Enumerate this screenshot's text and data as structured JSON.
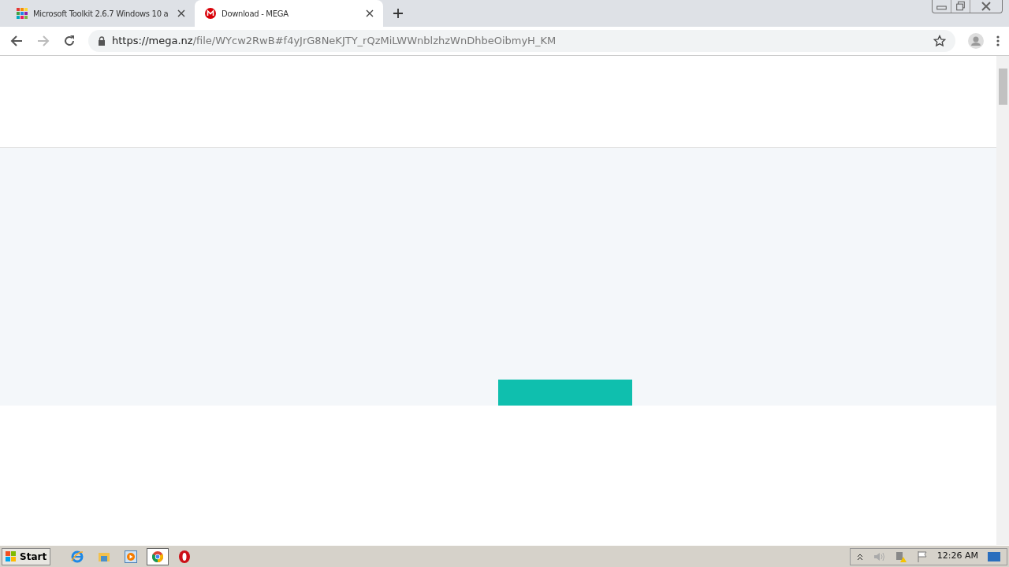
{
  "tabs": [
    {
      "title": "Microsoft Toolkit 2.6.7 Windows 10 a",
      "selected": false,
      "kind": "grid"
    },
    {
      "title": "Download - MEGA",
      "selected": true,
      "kind": "mega"
    }
  ],
  "address": {
    "scheme_host": "https://mega.nz",
    "path": "/file/WYcw2RwB#f4yJrG8NeKJTY_rQzMiLWWnblzhzWnDhbeOibmyH_KM"
  },
  "taskbar": {
    "start": "Start",
    "apps": [
      {
        "kind": "ie",
        "selected": false
      },
      {
        "kind": "folder",
        "selected": false
      },
      {
        "kind": "media",
        "selected": false
      },
      {
        "kind": "chrome",
        "selected": true
      },
      {
        "kind": "opera",
        "selected": false
      }
    ],
    "clock": "12:26 AM"
  }
}
